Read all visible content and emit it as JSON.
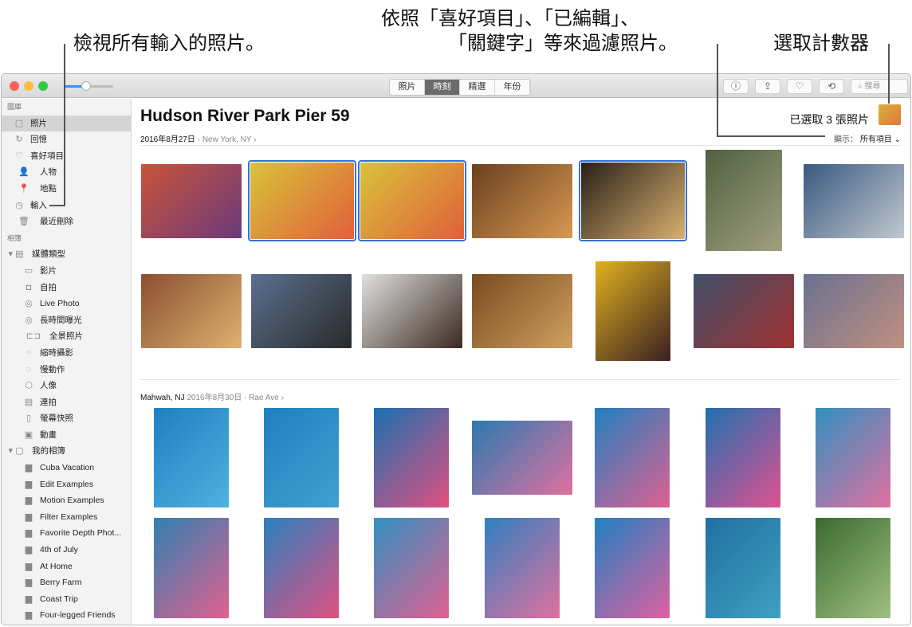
{
  "annotations": {
    "import": "檢視所有輸入的照片。",
    "filter_line1": "依照「喜好項目」、「已編輯」、",
    "filter_line2": "「關鍵字」等來過濾照片。",
    "counter": "選取計數器"
  },
  "toolbar": {
    "tabs": [
      {
        "label": "照片"
      },
      {
        "label": "時刻",
        "active": true
      },
      {
        "label": "精選"
      },
      {
        "label": "年份"
      }
    ],
    "search_placeholder": "搜尋",
    "buttons": [
      "info-icon",
      "share-icon",
      "heart-icon",
      "rotate-icon"
    ]
  },
  "sidebar": {
    "library_header": "圖庫",
    "library": [
      {
        "label": "照片",
        "icon": "▢",
        "selected": true
      },
      {
        "label": "回憶",
        "icon": "↻"
      },
      {
        "label": "喜好項目",
        "icon": "♡"
      },
      {
        "label": "人物",
        "icon": "👤"
      },
      {
        "label": "地點",
        "icon": "📍"
      },
      {
        "label": "輸入",
        "icon": "◷"
      },
      {
        "label": "最近刪除",
        "icon": "🗑"
      }
    ],
    "albums_header": "相簿",
    "media_types": {
      "label": "媒體類型",
      "items": [
        {
          "label": "影片",
          "icon": "▭"
        },
        {
          "label": "自拍",
          "icon": "◘"
        },
        {
          "label": "Live Photo",
          "icon": "◎"
        },
        {
          "label": "長時間曝光",
          "icon": "◎"
        },
        {
          "label": "全景照片",
          "icon": "⊏⊐"
        },
        {
          "label": "縮時攝影",
          "icon": "⁘"
        },
        {
          "label": "慢動作",
          "icon": "◌"
        },
        {
          "label": "人像",
          "icon": "⬡"
        },
        {
          "label": "連拍",
          "icon": "▤"
        },
        {
          "label": "螢幕快照",
          "icon": "▯"
        },
        {
          "label": "動畫",
          "icon": "▣"
        }
      ]
    },
    "my_albums": {
      "label": "我的相簿",
      "items": [
        "Cuba Vacation",
        "Edit Examples",
        "Motion Examples",
        "Filter Examples",
        "Favorite Depth Phot...",
        "4th of July",
        "At Home",
        "Berry Farm",
        "Coast Trip",
        "Four-legged Friends"
      ]
    }
  },
  "main": {
    "title": "Hudson River Park Pier 59",
    "selection_count": "已選取 3 張照片",
    "show_label": "顯示：",
    "show_value": "所有項目",
    "moment1": {
      "date": "2016年8月27日",
      "location": "New York, NY"
    },
    "moment2": {
      "place": "Mahwah, NJ",
      "date": "2016年8月30日",
      "location": "Rae Ave"
    },
    "selected_photos": [
      1,
      2,
      4
    ]
  },
  "colors": {
    "accent": "#2f74d8",
    "selected_tab": "#6b6b6b",
    "traffic": [
      "#fc605b",
      "#fdbc40",
      "#34c84a"
    ]
  }
}
